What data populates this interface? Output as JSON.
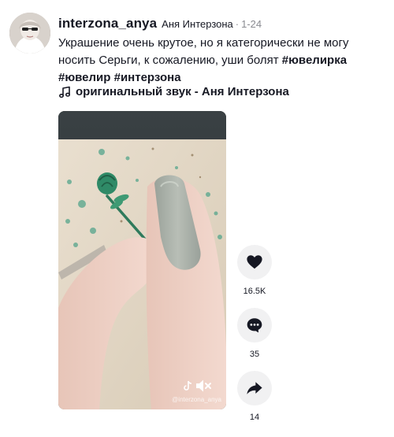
{
  "post": {
    "username": "interzona_anya",
    "nickname": "Аня Интерзона",
    "separator": "·",
    "date": "1-24",
    "caption_text": "Украшение очень крутое, но я категорически не могу носить Серьги, к сожалению, уши болят",
    "hashtags": [
      "#ювелирка",
      "#ювелир",
      "#интерзона"
    ],
    "music": "оригинальный звук - Аня Интерзона"
  },
  "video": {
    "watermark": "@interzona_anya",
    "mute_icon": "speaker-muted-icon"
  },
  "actions": {
    "like": {
      "icon": "heart-icon",
      "count": "16.5K"
    },
    "comment": {
      "icon": "comment-icon",
      "count": "35"
    },
    "share": {
      "icon": "share-icon",
      "count": "14"
    }
  },
  "colors": {
    "text": "#161823",
    "muted": "#8a8b91",
    "action_bg": "#f1f1f2"
  }
}
